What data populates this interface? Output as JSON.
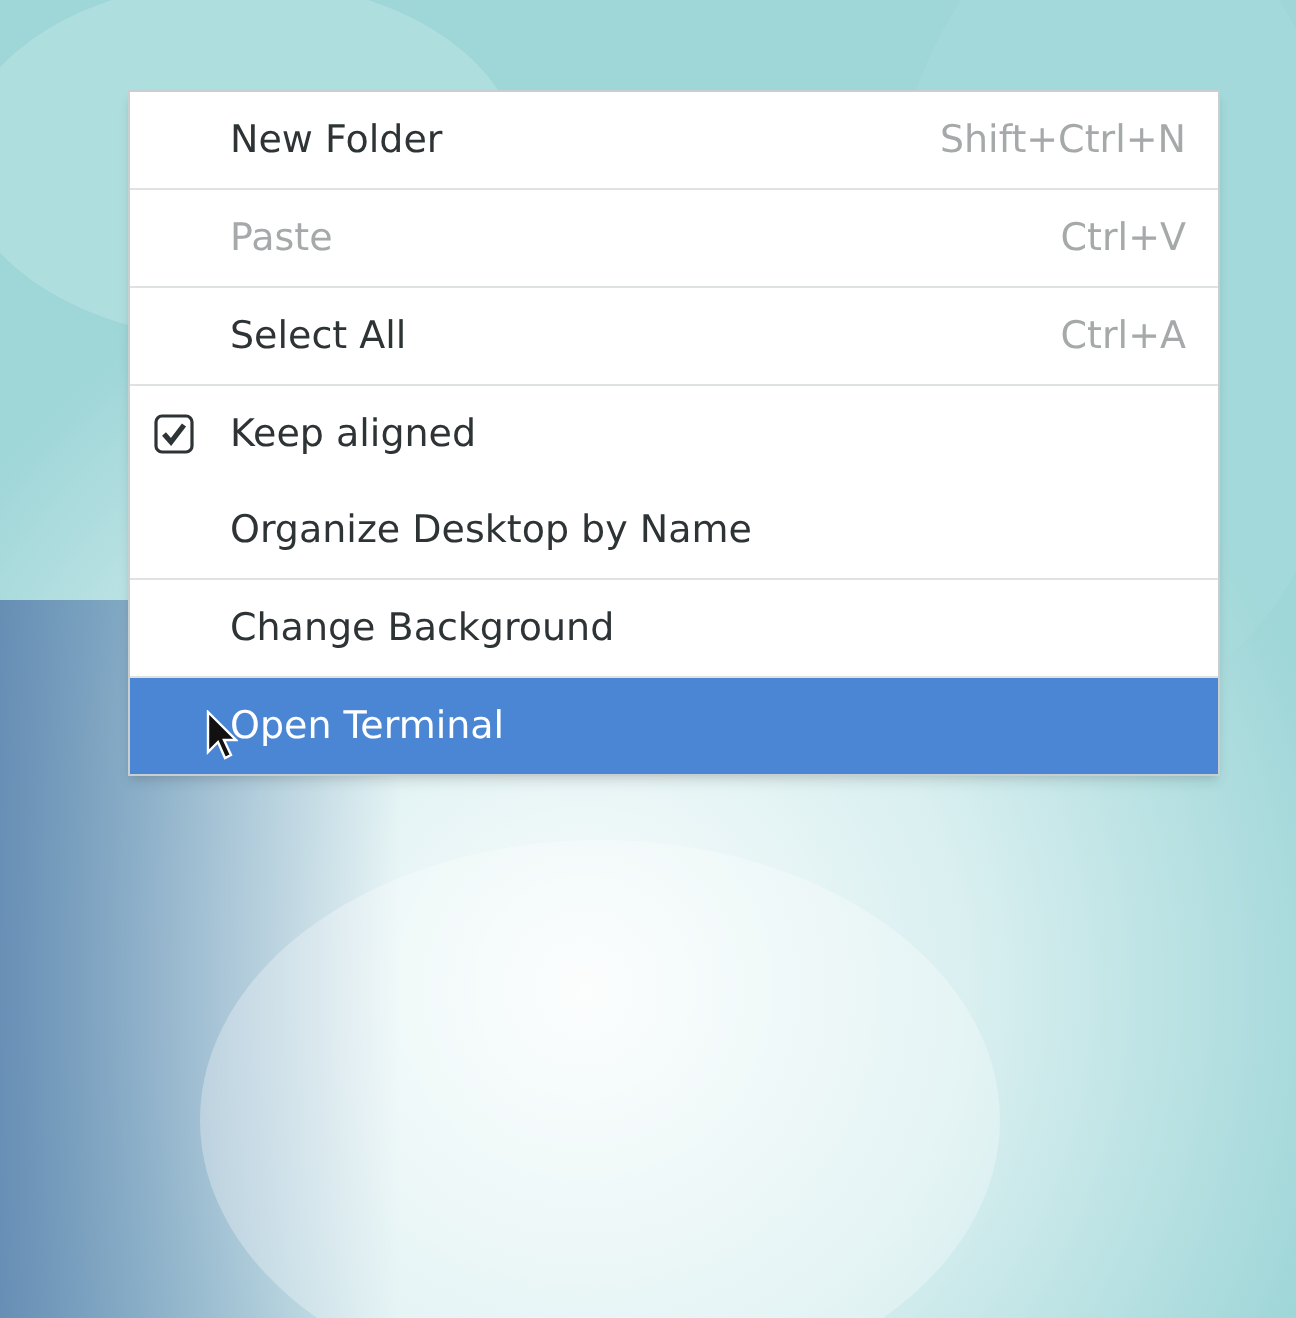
{
  "context_menu": {
    "items": [
      {
        "kind": "item",
        "label": "New Folder",
        "shortcut": "Shift+Ctrl+N",
        "disabled": false,
        "selected": false,
        "separator_before": false
      },
      {
        "kind": "item",
        "label": "Paste",
        "shortcut": "Ctrl+V",
        "disabled": true,
        "selected": false,
        "separator_before": true
      },
      {
        "kind": "item",
        "label": "Select All",
        "shortcut": "Ctrl+A",
        "disabled": false,
        "selected": false,
        "separator_before": true
      },
      {
        "kind": "check",
        "label": "Keep aligned",
        "checked": true,
        "disabled": false,
        "selected": false,
        "separator_before": true
      },
      {
        "kind": "item",
        "label": "Organize Desktop by Name",
        "disabled": false,
        "selected": false,
        "separator_before": false
      },
      {
        "kind": "item",
        "label": "Change Background",
        "disabled": false,
        "selected": false,
        "separator_before": true
      },
      {
        "kind": "item",
        "label": "Open Terminal",
        "disabled": false,
        "selected": true,
        "separator_before": true
      }
    ]
  }
}
